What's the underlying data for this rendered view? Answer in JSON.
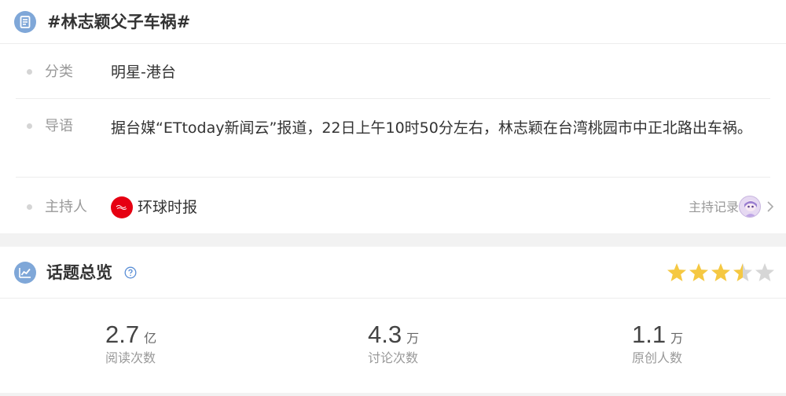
{
  "topic": {
    "title": "#林志颖父子车祸#",
    "header_icon": "document-list-icon"
  },
  "info": {
    "category": {
      "label": "分类",
      "value": "明星-港台"
    },
    "intro": {
      "label": "导语",
      "value": "据台媒“ETtoday新闻云”报道，22日上午10时50分左右，林志颖在台湾桃园市中正北路出车祸。"
    },
    "host": {
      "label": "主持人",
      "name": "环球时报",
      "record_label": "主持记录"
    }
  },
  "overview": {
    "title": "话题总览",
    "header_icon": "chart-trend-icon",
    "help_icon": "question-circle-icon",
    "rating": {
      "value": 3.5,
      "max": 5,
      "star_color": "#f5c842",
      "empty_color": "#d6d6d6"
    },
    "stats": [
      {
        "value": "2.7",
        "unit": "亿",
        "label": "阅读次数"
      },
      {
        "value": "4.3",
        "unit": "万",
        "label": "讨论次数"
      },
      {
        "value": "1.1",
        "unit": "万",
        "label": "原创人数"
      }
    ]
  },
  "colors": {
    "accent_icon": "#7fa7d8",
    "host_avatar": "#e60012",
    "muted_text": "#999999"
  }
}
